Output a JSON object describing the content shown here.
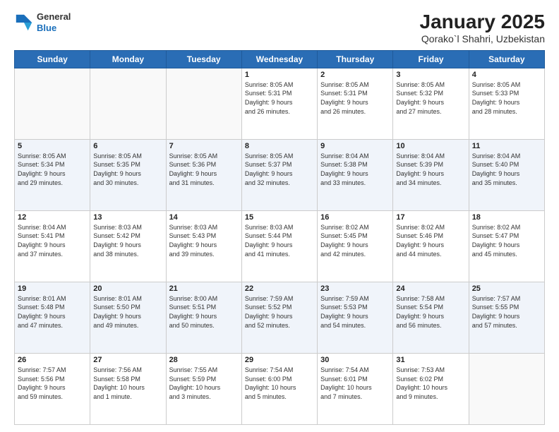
{
  "logo": {
    "general": "General",
    "blue": "Blue"
  },
  "title": "January 2025",
  "subtitle": "Qorako`l Shahri, Uzbekistan",
  "days_header": [
    "Sunday",
    "Monday",
    "Tuesday",
    "Wednesday",
    "Thursday",
    "Friday",
    "Saturday"
  ],
  "weeks": [
    [
      {
        "day": "",
        "info": ""
      },
      {
        "day": "",
        "info": ""
      },
      {
        "day": "",
        "info": ""
      },
      {
        "day": "1",
        "info": "Sunrise: 8:05 AM\nSunset: 5:31 PM\nDaylight: 9 hours\nand 26 minutes."
      },
      {
        "day": "2",
        "info": "Sunrise: 8:05 AM\nSunset: 5:31 PM\nDaylight: 9 hours\nand 26 minutes."
      },
      {
        "day": "3",
        "info": "Sunrise: 8:05 AM\nSunset: 5:32 PM\nDaylight: 9 hours\nand 27 minutes."
      },
      {
        "day": "4",
        "info": "Sunrise: 8:05 AM\nSunset: 5:33 PM\nDaylight: 9 hours\nand 28 minutes."
      }
    ],
    [
      {
        "day": "5",
        "info": "Sunrise: 8:05 AM\nSunset: 5:34 PM\nDaylight: 9 hours\nand 29 minutes."
      },
      {
        "day": "6",
        "info": "Sunrise: 8:05 AM\nSunset: 5:35 PM\nDaylight: 9 hours\nand 30 minutes."
      },
      {
        "day": "7",
        "info": "Sunrise: 8:05 AM\nSunset: 5:36 PM\nDaylight: 9 hours\nand 31 minutes."
      },
      {
        "day": "8",
        "info": "Sunrise: 8:05 AM\nSunset: 5:37 PM\nDaylight: 9 hours\nand 32 minutes."
      },
      {
        "day": "9",
        "info": "Sunrise: 8:04 AM\nSunset: 5:38 PM\nDaylight: 9 hours\nand 33 minutes."
      },
      {
        "day": "10",
        "info": "Sunrise: 8:04 AM\nSunset: 5:39 PM\nDaylight: 9 hours\nand 34 minutes."
      },
      {
        "day": "11",
        "info": "Sunrise: 8:04 AM\nSunset: 5:40 PM\nDaylight: 9 hours\nand 35 minutes."
      }
    ],
    [
      {
        "day": "12",
        "info": "Sunrise: 8:04 AM\nSunset: 5:41 PM\nDaylight: 9 hours\nand 37 minutes."
      },
      {
        "day": "13",
        "info": "Sunrise: 8:03 AM\nSunset: 5:42 PM\nDaylight: 9 hours\nand 38 minutes."
      },
      {
        "day": "14",
        "info": "Sunrise: 8:03 AM\nSunset: 5:43 PM\nDaylight: 9 hours\nand 39 minutes."
      },
      {
        "day": "15",
        "info": "Sunrise: 8:03 AM\nSunset: 5:44 PM\nDaylight: 9 hours\nand 41 minutes."
      },
      {
        "day": "16",
        "info": "Sunrise: 8:02 AM\nSunset: 5:45 PM\nDaylight: 9 hours\nand 42 minutes."
      },
      {
        "day": "17",
        "info": "Sunrise: 8:02 AM\nSunset: 5:46 PM\nDaylight: 9 hours\nand 44 minutes."
      },
      {
        "day": "18",
        "info": "Sunrise: 8:02 AM\nSunset: 5:47 PM\nDaylight: 9 hours\nand 45 minutes."
      }
    ],
    [
      {
        "day": "19",
        "info": "Sunrise: 8:01 AM\nSunset: 5:48 PM\nDaylight: 9 hours\nand 47 minutes."
      },
      {
        "day": "20",
        "info": "Sunrise: 8:01 AM\nSunset: 5:50 PM\nDaylight: 9 hours\nand 49 minutes."
      },
      {
        "day": "21",
        "info": "Sunrise: 8:00 AM\nSunset: 5:51 PM\nDaylight: 9 hours\nand 50 minutes."
      },
      {
        "day": "22",
        "info": "Sunrise: 7:59 AM\nSunset: 5:52 PM\nDaylight: 9 hours\nand 52 minutes."
      },
      {
        "day": "23",
        "info": "Sunrise: 7:59 AM\nSunset: 5:53 PM\nDaylight: 9 hours\nand 54 minutes."
      },
      {
        "day": "24",
        "info": "Sunrise: 7:58 AM\nSunset: 5:54 PM\nDaylight: 9 hours\nand 56 minutes."
      },
      {
        "day": "25",
        "info": "Sunrise: 7:57 AM\nSunset: 5:55 PM\nDaylight: 9 hours\nand 57 minutes."
      }
    ],
    [
      {
        "day": "26",
        "info": "Sunrise: 7:57 AM\nSunset: 5:56 PM\nDaylight: 9 hours\nand 59 minutes."
      },
      {
        "day": "27",
        "info": "Sunrise: 7:56 AM\nSunset: 5:58 PM\nDaylight: 10 hours\nand 1 minute."
      },
      {
        "day": "28",
        "info": "Sunrise: 7:55 AM\nSunset: 5:59 PM\nDaylight: 10 hours\nand 3 minutes."
      },
      {
        "day": "29",
        "info": "Sunrise: 7:54 AM\nSunset: 6:00 PM\nDaylight: 10 hours\nand 5 minutes."
      },
      {
        "day": "30",
        "info": "Sunrise: 7:54 AM\nSunset: 6:01 PM\nDaylight: 10 hours\nand 7 minutes."
      },
      {
        "day": "31",
        "info": "Sunrise: 7:53 AM\nSunset: 6:02 PM\nDaylight: 10 hours\nand 9 minutes."
      },
      {
        "day": "",
        "info": ""
      }
    ]
  ]
}
